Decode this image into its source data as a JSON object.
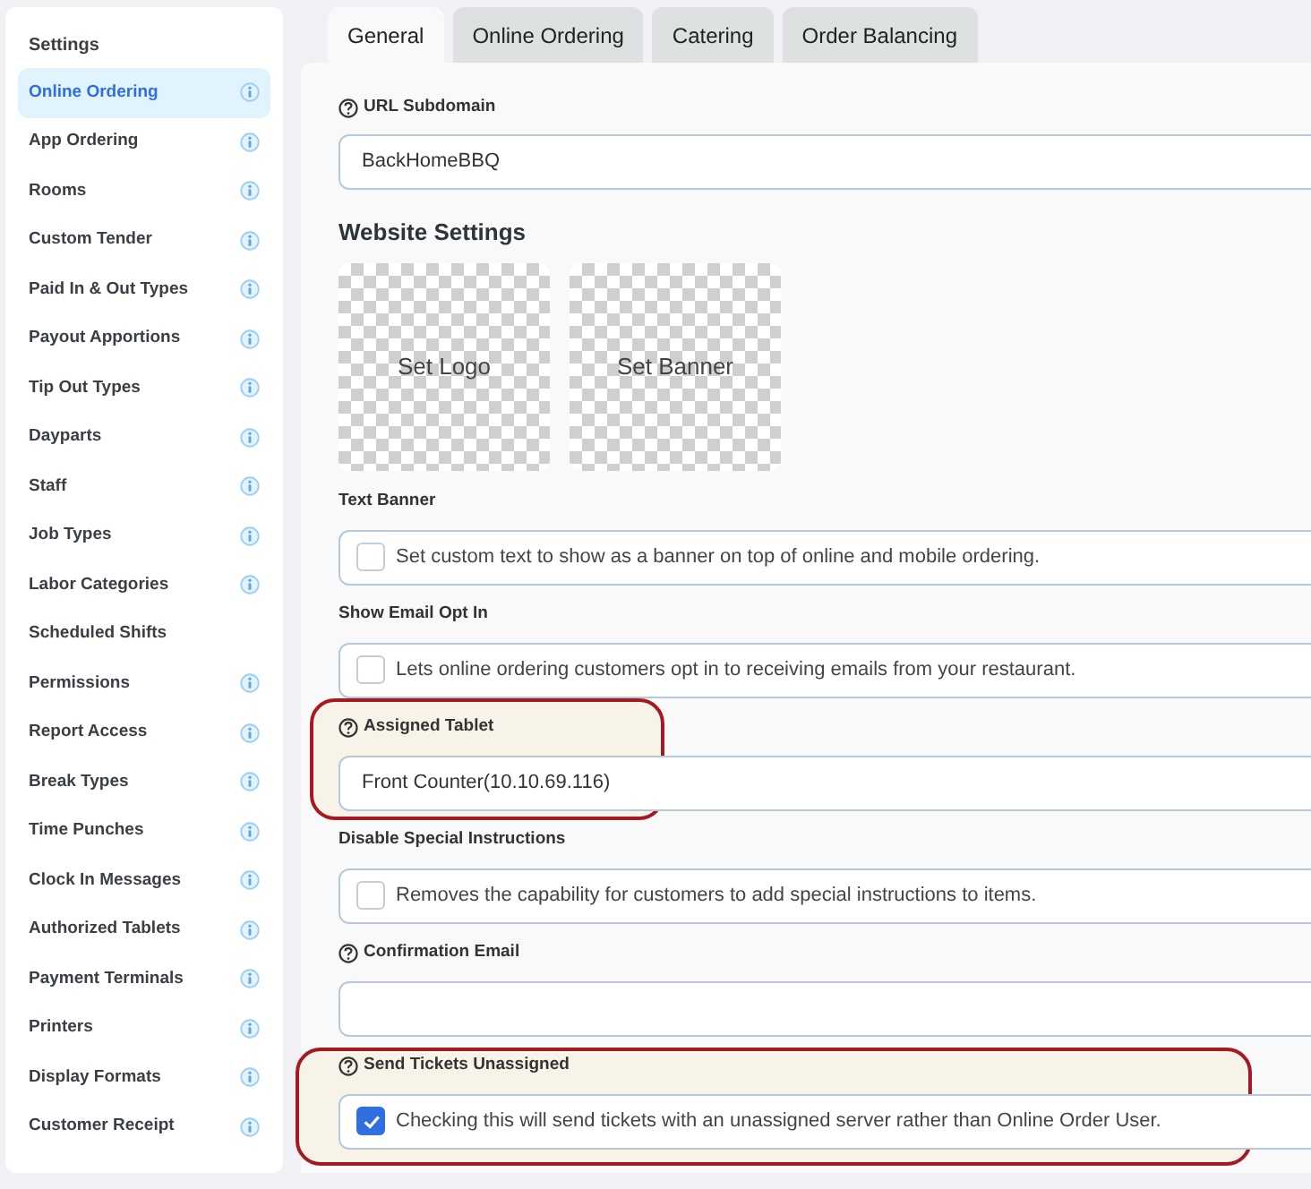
{
  "sidebar": {
    "title": "Settings",
    "items": [
      {
        "label": "Online Ordering",
        "selected": true,
        "info": true
      },
      {
        "label": "App Ordering",
        "selected": false,
        "info": true
      },
      {
        "label": "Rooms",
        "selected": false,
        "info": true
      },
      {
        "label": "Custom Tender",
        "selected": false,
        "info": true
      },
      {
        "label": "Paid In & Out Types",
        "selected": false,
        "info": true
      },
      {
        "label": "Payout Apportions",
        "selected": false,
        "info": true
      },
      {
        "label": "Tip Out Types",
        "selected": false,
        "info": true
      },
      {
        "label": "Dayparts",
        "selected": false,
        "info": true
      },
      {
        "label": "Staff",
        "selected": false,
        "info": true
      },
      {
        "label": "Job Types",
        "selected": false,
        "info": true
      },
      {
        "label": "Labor Categories",
        "selected": false,
        "info": true
      },
      {
        "label": "Scheduled Shifts",
        "selected": false,
        "info": false
      },
      {
        "label": "Permissions",
        "selected": false,
        "info": true
      },
      {
        "label": "Report Access",
        "selected": false,
        "info": true
      },
      {
        "label": "Break Types",
        "selected": false,
        "info": true
      },
      {
        "label": "Time Punches",
        "selected": false,
        "info": true
      },
      {
        "label": "Clock In Messages",
        "selected": false,
        "info": true
      },
      {
        "label": "Authorized Tablets",
        "selected": false,
        "info": true
      },
      {
        "label": "Payment Terminals",
        "selected": false,
        "info": true
      },
      {
        "label": "Printers",
        "selected": false,
        "info": true
      },
      {
        "label": "Display Formats",
        "selected": false,
        "info": true
      },
      {
        "label": "Customer Receipt",
        "selected": false,
        "info": true
      }
    ]
  },
  "tabs": [
    {
      "label": "General",
      "selected": true
    },
    {
      "label": "Online Ordering",
      "selected": false
    },
    {
      "label": "Catering",
      "selected": false
    },
    {
      "label": "Order Balancing",
      "selected": false
    }
  ],
  "sections": [
    {
      "kind": "text",
      "label": "URL Subdomain",
      "help": true,
      "value": "BackHomeBBQ",
      "highlighted": false
    },
    {
      "kind": "heading",
      "label": "Website Settings"
    },
    {
      "kind": "images",
      "tiles": [
        "Set Logo",
        "Set Banner"
      ]
    },
    {
      "kind": "checkbox",
      "label": "Text Banner",
      "help": false,
      "text": "Set custom text to show as a banner on top of online and mobile ordering.",
      "checked": false,
      "highlighted": false
    },
    {
      "kind": "checkbox",
      "label": "Show Email Opt In",
      "help": false,
      "text": "Lets online ordering customers opt in to receiving emails from your restaurant.",
      "checked": false,
      "highlighted": false
    },
    {
      "kind": "text",
      "label": "Assigned Tablet",
      "help": true,
      "value": "Front Counter(10.10.69.116)",
      "highlighted": true
    },
    {
      "kind": "checkbox",
      "label": "Disable Special Instructions",
      "help": false,
      "text": "Removes the capability for customers to add special instructions to items.",
      "checked": false,
      "highlighted": false
    },
    {
      "kind": "text",
      "label": "Confirmation Email",
      "help": true,
      "highlighted": false
    },
    {
      "kind": "checkbox",
      "label": "Send Tickets Unassigned",
      "help": true,
      "text": "Checking this will send tickets with an unassigned server rather than Online Order User.",
      "checked": true,
      "highlighted": true
    }
  ]
}
